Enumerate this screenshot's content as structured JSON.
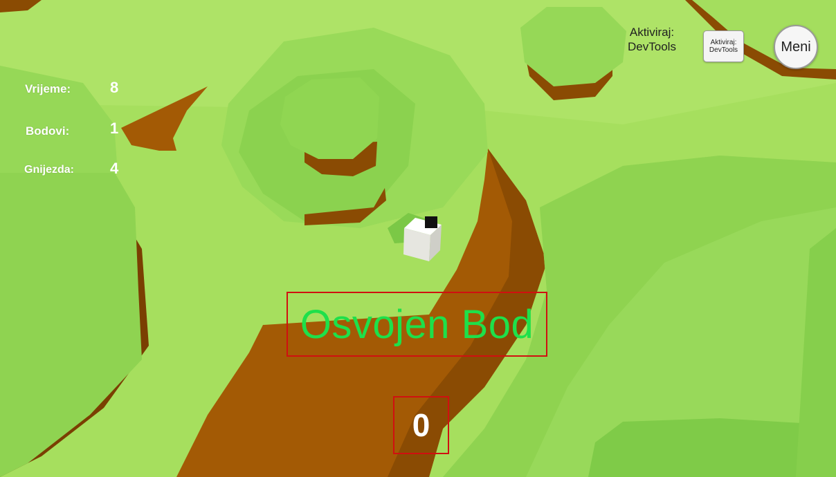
{
  "hud": {
    "time_label": "Vrijeme:",
    "time_value": "8",
    "points_label": "Bodovi:",
    "points_value": "1",
    "nests_label": "Gnijezda:",
    "nests_value": "4"
  },
  "toolbar": {
    "devtools_label_line1": "Aktiviraj:",
    "devtools_label_line2": "DevTools",
    "devtools_button_line1": "Aktiviraj:",
    "devtools_button_line2": "DevTools",
    "menu_label": "Meni"
  },
  "center": {
    "banner_text": "Osvojen Bod",
    "counter": "0"
  },
  "colors": {
    "grass_light": "#a9e160",
    "grass_mid": "#8fd653",
    "grass_dark": "#78c946",
    "dirt": "#a35a05",
    "dirt_dark": "#7e4402",
    "banner_text": "#1ee04a",
    "highlight_box": "#d01010"
  }
}
